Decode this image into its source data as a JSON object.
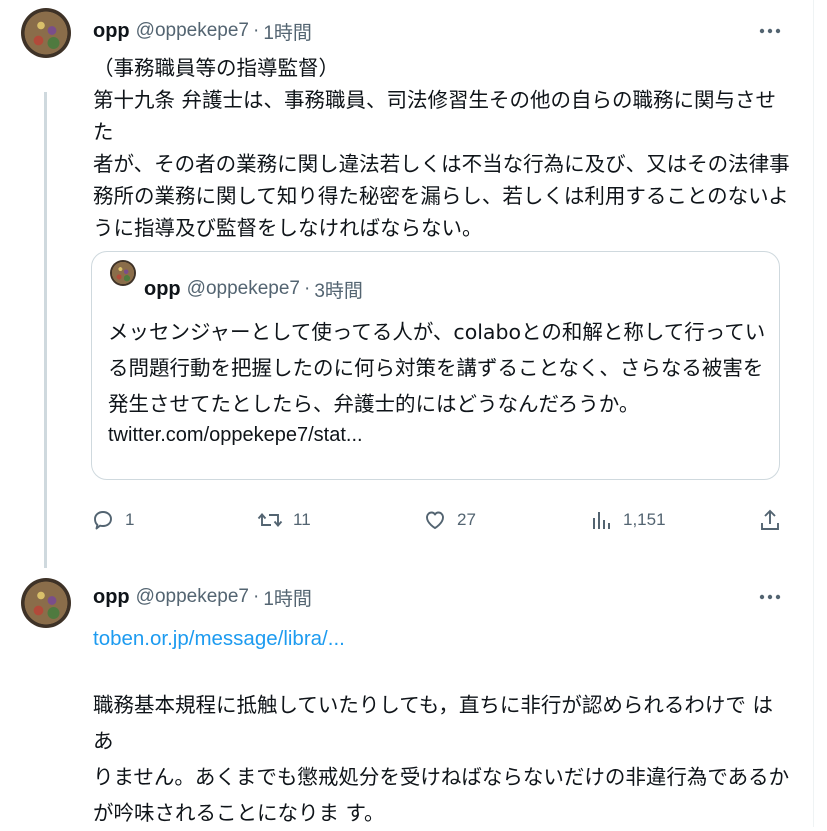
{
  "tweets": [
    {
      "author": {
        "name": "opp",
        "handle": "@oppekepe7",
        "separator": "·",
        "time": "1時間"
      },
      "lines": [
        "（事務職員等の指導監督）",
        "第十九条 弁護士は、事務職員、司法修習生その他の自らの職務に関与させた",
        "者が、その者の業務に関し違法若しくは不当な行為に及び、又はその法律事",
        "務所の業務に関して知り得た秘密を漏らし、若しくは利用することのないよ",
        "うに指導及び監督をしなければならない。"
      ],
      "quote": {
        "author": {
          "name": "opp",
          "handle": "@oppekepe7",
          "separator": "·",
          "time": "3時間"
        },
        "lines": [
          "メッセンジャーとして使ってる人が、colaboとの和解と称して行ってい",
          "る問題行動を把握したのに何ら対策を講ずることなく、さらなる被害を",
          "発生させてたとしたら、弁護士的にはどうなんだろうか。"
        ],
        "link": "twitter.com/oppekepe7/stat..."
      },
      "actions": {
        "replies": "1",
        "retweets": "11",
        "likes": "27",
        "views": "1,151"
      }
    },
    {
      "author": {
        "name": "opp",
        "handle": "@oppekepe7",
        "separator": "·",
        "time": "1時間"
      },
      "link": "toben.or.jp/message/libra/...",
      "lines": [
        "職務基本規程に抵触していたりしても，直ちに非行が認められるわけで はあ",
        "りません。あくまでも懲戒処分を受けねばならないだけの非違行為であるか",
        "が吟味されることになりま す。"
      ]
    }
  ],
  "colors": {
    "text": "#0f1419",
    "secondary": "#536471",
    "link": "#1d9bf0",
    "border": "#cfd9de"
  },
  "icons": [
    "more-icon",
    "reply-icon",
    "retweet-icon",
    "like-icon",
    "views-icon",
    "share-icon"
  ]
}
